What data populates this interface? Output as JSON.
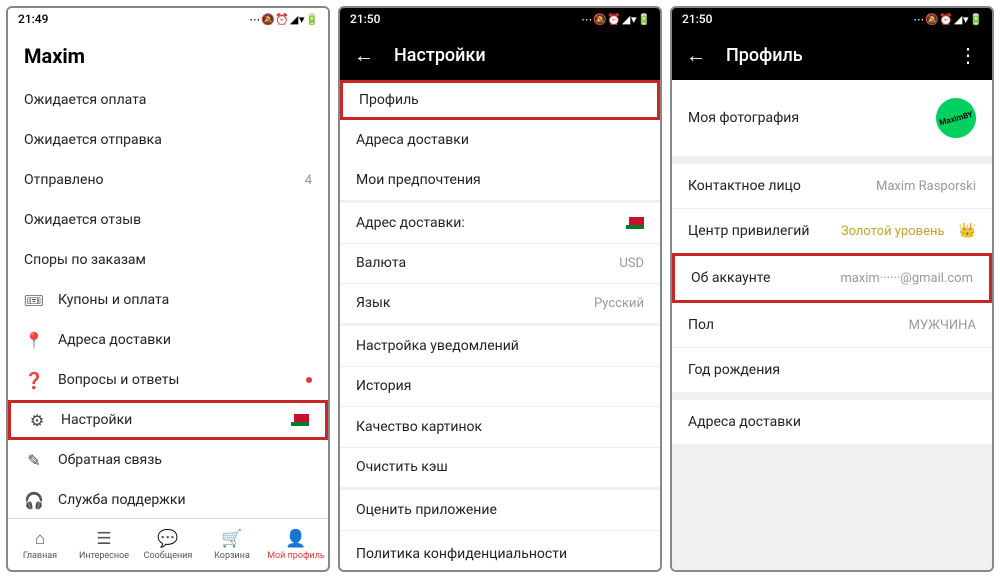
{
  "status": {
    "time1": "21:49",
    "time2": "21:50",
    "time3": "21:50",
    "icons": "⋯  🔕 ⏰ ◢ ▾ 🔋"
  },
  "p1": {
    "title": "Maxim",
    "rows": {
      "awaiting_payment": "Ожидается оплата",
      "awaiting_shipment": "Ожидается отправка",
      "shipped": "Отправлено",
      "shipped_count": "4",
      "awaiting_review": "Ожидается отзыв",
      "disputes": "Споры по заказам",
      "coupons": "Купоны и оплата",
      "addresses": "Адреса доставки",
      "qa": "Вопросы и ответы",
      "settings": "Настройки",
      "feedback": "Обратная связь",
      "support": "Служба поддержки"
    },
    "nav": {
      "home": "Главная",
      "feed": "Интересное",
      "messages": "Сообщения",
      "cart": "Корзина",
      "profile": "Мой профиль"
    }
  },
  "p2": {
    "header": "Настройки",
    "rows": {
      "profile": "Профиль",
      "ship_addresses": "Адреса доставки",
      "preferences": "Мои предпочтения",
      "ship_address_single": "Адрес доставки:",
      "currency": "Валюта",
      "currency_val": "USD",
      "language": "Язык",
      "language_val": "Русский",
      "notifications": "Настройка уведомлений",
      "history": "История",
      "image_quality": "Качество картинок",
      "clear_cache": "Очистить кэш",
      "rate": "Оценить приложение",
      "privacy": "Политика конфиденциальности"
    }
  },
  "p3": {
    "header": "Профиль",
    "avatar_text": "MaximBY",
    "rows": {
      "photo": "Моя фотография",
      "contact": "Контактное лицо",
      "contact_val": "Maxim Rasporski",
      "privilege": "Центр привилегий",
      "privilege_val": "Золотой уровень",
      "account": "Об аккаунте",
      "account_val": "maxim······@gmail.com",
      "gender": "Пол",
      "gender_val": "МУЖЧИНА",
      "birth": "Год рождения",
      "addresses": "Адреса доставки"
    }
  }
}
